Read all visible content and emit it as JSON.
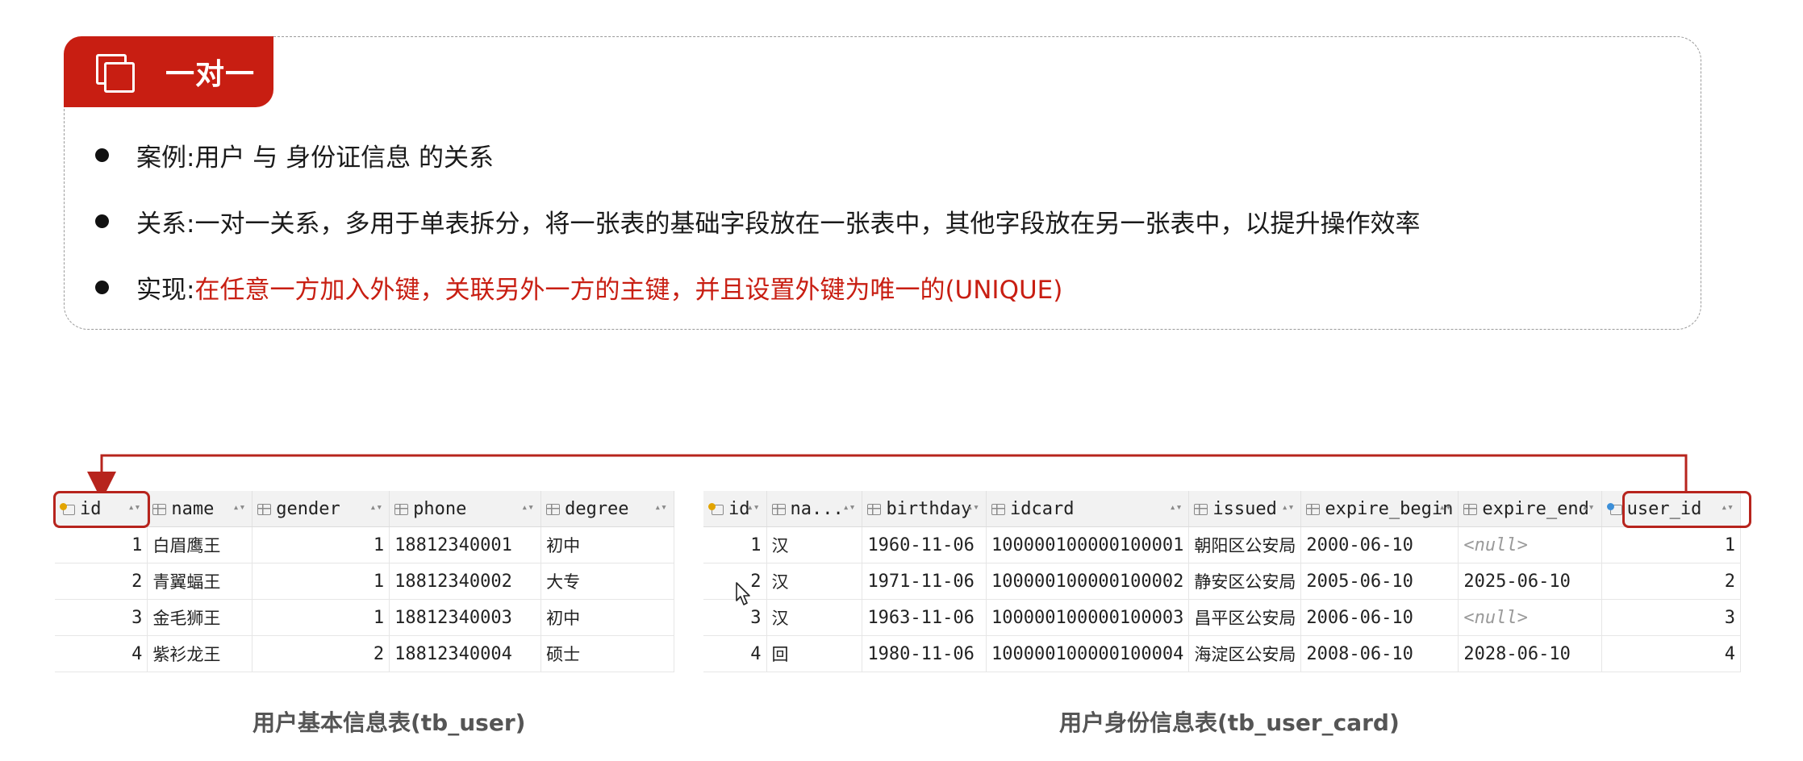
{
  "card": {
    "title": "一对一",
    "bullets": [
      {
        "label": "案例: ",
        "text": "用户 与 身份证信息 的关系",
        "highlight": ""
      },
      {
        "label": "关系: ",
        "text": "一对一关系，多用于单表拆分，将一张表的基础字段放在一张表中，其他字段放在另一张表中，以提升操作效率",
        "highlight": ""
      },
      {
        "label": "实现: ",
        "text": "",
        "highlight": "在任意一方加入外键，关联另外一方的主键，并且设置外键为唯一的(UNIQUE)"
      }
    ]
  },
  "colors": {
    "accent": "#c81e12",
    "highlight_border": "#b7241d",
    "connector": "#b7241d"
  },
  "tb_user": {
    "caption": "用户基本信息表(tb_user)",
    "columns": [
      "id",
      "name",
      "gender",
      "phone",
      "degree"
    ],
    "rows": [
      [
        "1",
        "白眉鹰王",
        "1",
        "18812340001",
        "初中"
      ],
      [
        "2",
        "青翼蝠王",
        "1",
        "18812340002",
        "大专"
      ],
      [
        "3",
        "金毛狮王",
        "1",
        "18812340003",
        "初中"
      ],
      [
        "4",
        "紫衫龙王",
        "2",
        "18812340004",
        "硕士"
      ]
    ]
  },
  "tb_user_card": {
    "caption": "用户身份信息表(tb_user_card)",
    "columns": [
      "id",
      "na...",
      "birthday",
      "idcard",
      "issued",
      "expire_begin",
      "expire_end",
      "user_id"
    ],
    "rows": [
      [
        "1",
        "汉",
        "1960-11-06",
        "100000100000100001",
        "朝阳区公安局",
        "2000-06-10",
        "<null>",
        "1"
      ],
      [
        "2",
        "汉",
        "1971-11-06",
        "100000100000100002",
        "静安区公安局",
        "2005-06-10",
        "2025-06-10",
        "2"
      ],
      [
        "3",
        "汉",
        "1963-11-06",
        "100000100000100003",
        "昌平区公安局",
        "2006-06-10",
        "<null>",
        "3"
      ],
      [
        "4",
        "回",
        "1980-11-06",
        "100000100000100004",
        "海淀区公安局",
        "2008-06-10",
        "2028-06-10",
        "4"
      ]
    ]
  },
  "icons": {
    "title": "copy-squares-icon",
    "pk_column": "primary-key-icon",
    "fk_column": "foreign-key-icon",
    "column": "column-icon",
    "sort": "sort-arrows-icon",
    "cursor": "mouse-cursor-icon"
  }
}
